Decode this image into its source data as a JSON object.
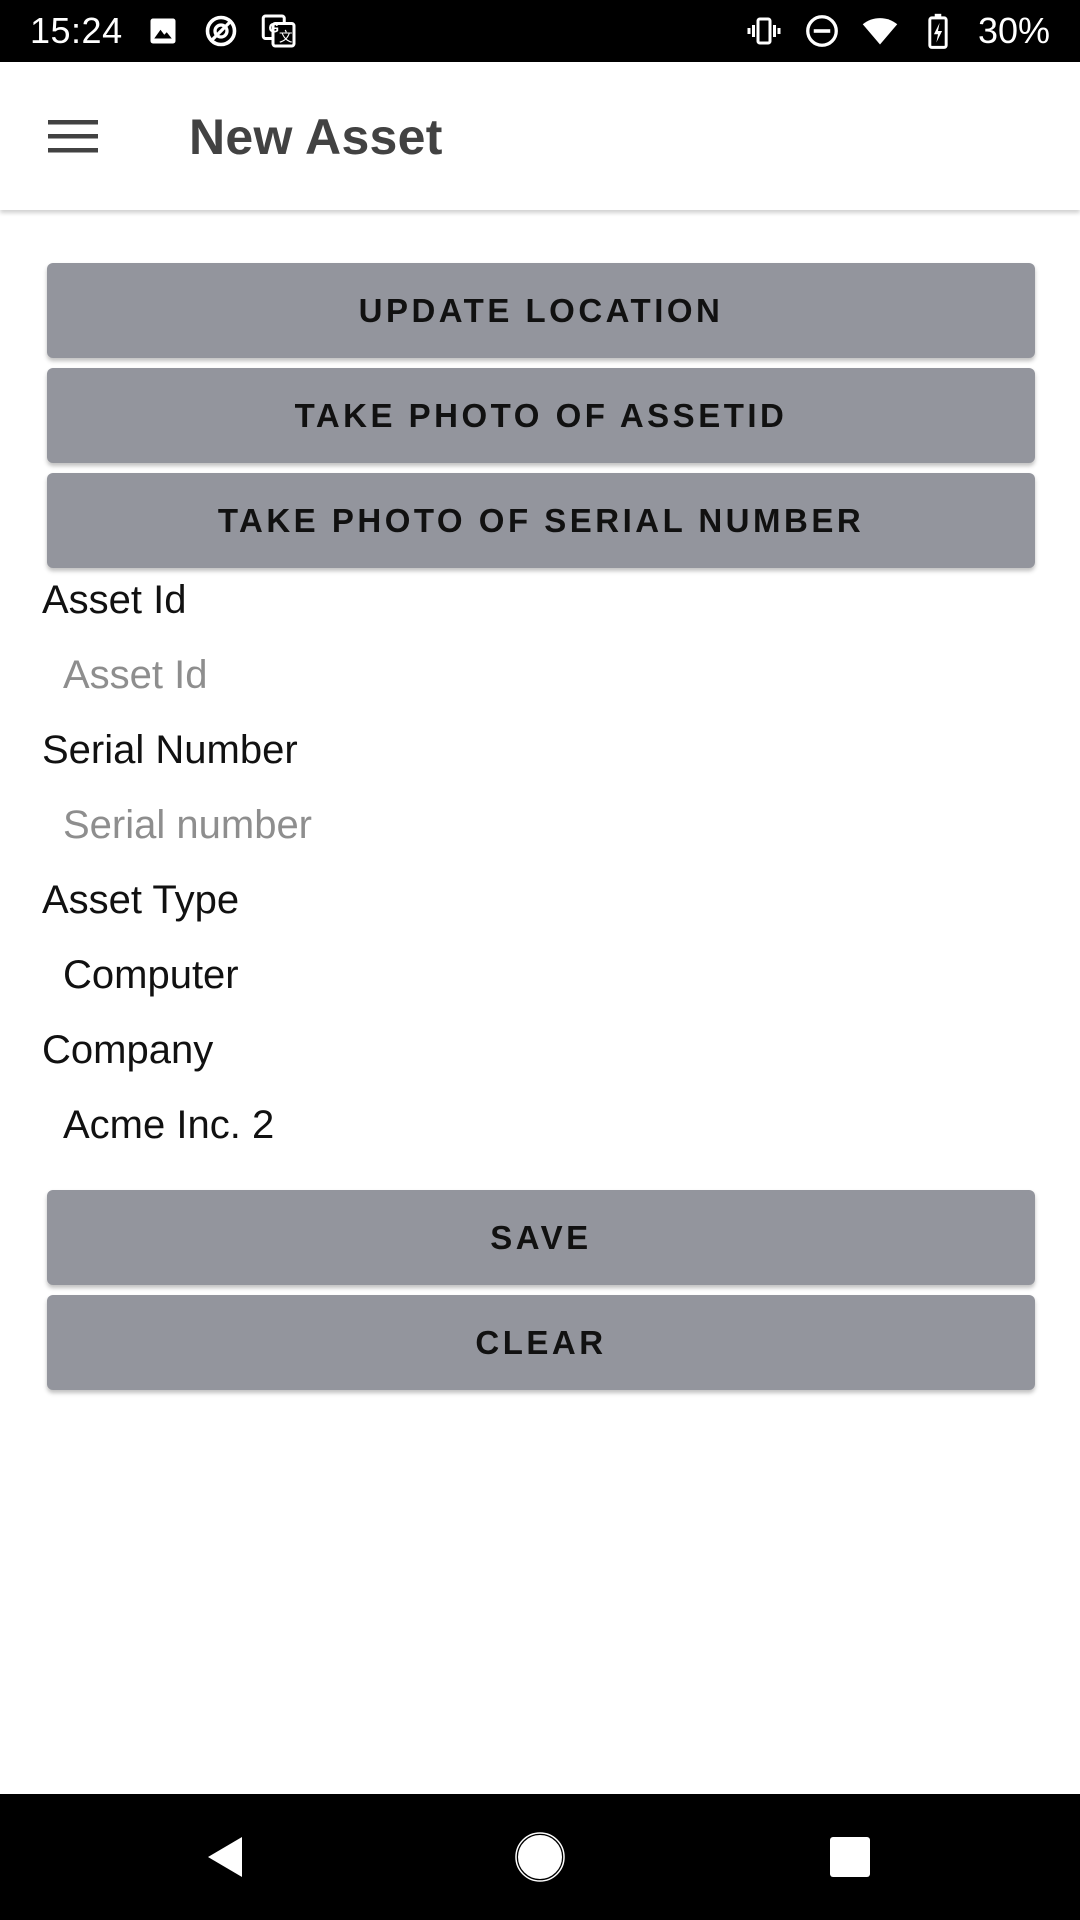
{
  "status_bar": {
    "time": "15:24",
    "battery_percent": "30%",
    "left_icons": [
      "image-icon",
      "sync-icon",
      "translate-icon"
    ],
    "right_icons": [
      "vibrate-icon",
      "do-not-disturb-icon",
      "wifi-icon",
      "battery-charging-icon"
    ]
  },
  "app_bar": {
    "title": "New Asset",
    "menu_icon": "hamburger-menu-icon"
  },
  "actions": {
    "update_location": "UPDATE LOCATION",
    "photo_asset_id": "TAKE PHOTO OF ASSETID",
    "photo_serial_number": "TAKE PHOTO OF SERIAL NUMBER"
  },
  "form": {
    "asset_id": {
      "label": "Asset Id",
      "value": "",
      "placeholder": "Asset Id"
    },
    "serial_number": {
      "label": "Serial Number",
      "value": "",
      "placeholder": "Serial number"
    },
    "asset_type": {
      "label": "Asset Type",
      "value": "Computer"
    },
    "company": {
      "label": "Company",
      "value": "Acme Inc. 2"
    }
  },
  "footer_actions": {
    "save": "SAVE",
    "clear": "CLEAR"
  },
  "nav_bar": {
    "icons": [
      "back-icon",
      "home-icon",
      "recents-icon"
    ]
  },
  "colors": {
    "button_bg": "#93959d",
    "button_text": "#111111",
    "status_bar_bg": "#000000",
    "nav_bar_bg": "#000000",
    "title_text": "#424242",
    "placeholder_text": "#8e8e8e"
  }
}
